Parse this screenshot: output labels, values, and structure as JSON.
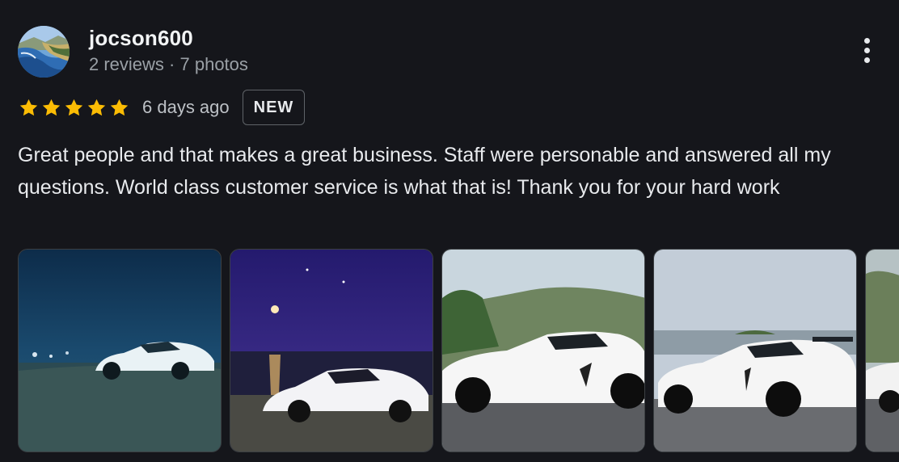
{
  "reviewer": {
    "name": "jocson600",
    "reviews_count": "2 reviews",
    "separator": "·",
    "photos_count": "7 photos",
    "avatar_icon": "landscape-avatar-icon"
  },
  "menu": {
    "icon": "more-vert-icon"
  },
  "rating": {
    "stars": 5,
    "max_stars": 5,
    "star_color": "#fbbc04",
    "time_ago": "6 days ago",
    "badge": "NEW"
  },
  "review": {
    "text": "Great people and that makes a great business. Staff were personable and answered all my questions. World class customer service is what that is! Thank you for your hard work"
  },
  "photos": [
    {
      "subject": "white-sports-car-at-night-beach"
    },
    {
      "subject": "white-sports-car-moonlit-sea"
    },
    {
      "subject": "white-sports-car-hills"
    },
    {
      "subject": "white-sports-car-coast-road"
    },
    {
      "subject": "white-sports-car-partial"
    }
  ],
  "theme": {
    "background": "#15161b",
    "text_primary": "#e8eaed",
    "text_secondary": "#9aa0a6"
  }
}
